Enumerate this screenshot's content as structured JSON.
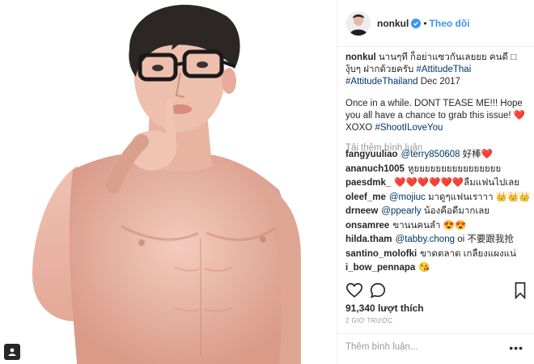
{
  "post": {
    "username": "nonkul",
    "follow_label": "Theo dõi",
    "dot": "•",
    "caption_user": "nonkul",
    "caption_line1": "นานๆที ก็อย่าแซวกันเลยยย คนดี □ งุ้บๆ ฝากด้วยครับ",
    "hashtag1": "#AttitudeThai",
    "hashtag2": "#AttitudeThailand",
    "caption_date": "Dec 2017",
    "caption_line2": "Once in a while. DONT TEASE ME!!! Hope you all have a chance to grab this issue!",
    "caption_heart": "❤️",
    "caption_xoxo": "XOXO",
    "hashtag3": "#ShootILoveYou",
    "load_more": "Tải thêm bình luận",
    "likes": "91,340 lượt thích",
    "time": "2 GIỜ TRƯỚC",
    "add_comment_placeholder": "Thêm bình luận...",
    "more_options": "•••"
  },
  "comments": [
    {
      "user": "fangyuuliao",
      "mention": "@terry850608",
      "text": "好棒❤️"
    },
    {
      "user": "ananuch1005",
      "mention": "",
      "text": "หูยยยยยยยยยยยยยยยย"
    },
    {
      "user": "paesdmk_",
      "mention": "",
      "text": "❤️❤️❤️❤️❤️❤️ลืมแฟนไปเลย"
    },
    {
      "user": "oleef_me",
      "mention": "@mojiuc",
      "text": "มาดูๆแฟนเราาา 👑👑👑"
    },
    {
      "user": "drneew",
      "mention": "@ppearly",
      "text": "น้องคือดีมากเลย"
    },
    {
      "user": "onsamree",
      "mention": "",
      "text": "ขานนคนล่ำ 😍😍"
    },
    {
      "user": "hilda.tham",
      "mention": "@tabby.chong",
      "text": "oi 不要跟我抢"
    },
    {
      "user": "santino_molofki",
      "mention": "",
      "text": "ขาดตลาด เกลี้ยงแผงแน่"
    },
    {
      "user": "i_bow_pennapa",
      "mention": "",
      "text": "😘"
    }
  ],
  "icons": {
    "like": "heart-icon",
    "comment": "comment-bubble-icon",
    "save": "bookmark-icon",
    "verified": "verified-badge-icon",
    "user_tag": "user-tag-icon"
  },
  "colors": {
    "link": "#3897f0",
    "hashtag": "#003569",
    "muted": "#999999",
    "text": "#262626"
  }
}
